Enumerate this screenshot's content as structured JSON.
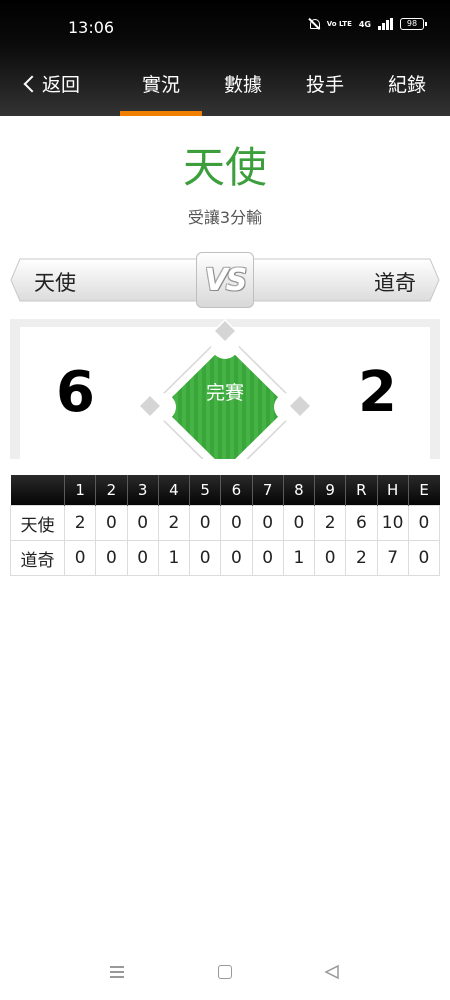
{
  "status_bar": {
    "time": "13:06",
    "volte": "Vo LTE",
    "network": "4G",
    "battery": "98"
  },
  "nav": {
    "back_label": "返回",
    "tabs": [
      "實況",
      "數據",
      "投手",
      "紀錄"
    ],
    "active_tab": 0
  },
  "result": {
    "title": "天使",
    "subtitle": "受讓3分輸"
  },
  "matchup": {
    "away_team": "天使",
    "home_team": "道奇",
    "vs_label": "VS"
  },
  "score": {
    "away": "6",
    "home": "2",
    "status": "完賽"
  },
  "line_score": {
    "headers": [
      "",
      "1",
      "2",
      "3",
      "4",
      "5",
      "6",
      "7",
      "8",
      "9",
      "R",
      "H",
      "E"
    ],
    "rows": [
      [
        "天使",
        "2",
        "0",
        "0",
        "2",
        "0",
        "0",
        "0",
        "0",
        "2",
        "6",
        "10",
        "0"
      ],
      [
        "道奇",
        "0",
        "0",
        "0",
        "1",
        "0",
        "0",
        "0",
        "1",
        "0",
        "2",
        "7",
        "0"
      ]
    ]
  },
  "colors": {
    "accent": "#f07e00",
    "field_green": "#3aa63a",
    "title_green": "#3c9f3c"
  }
}
